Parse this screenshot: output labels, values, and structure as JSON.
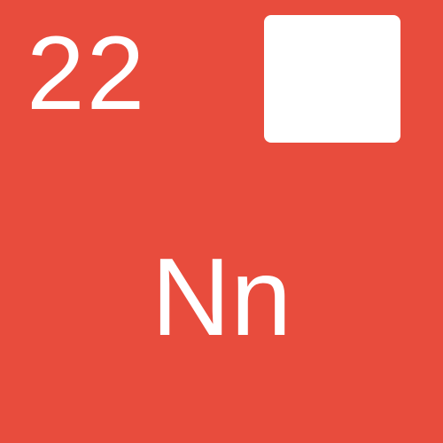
{
  "tile": {
    "number": "22",
    "symbol": "Nn",
    "background_color": "#e84c3d",
    "text_color": "#ffffff",
    "square_color": "#ffffff"
  }
}
